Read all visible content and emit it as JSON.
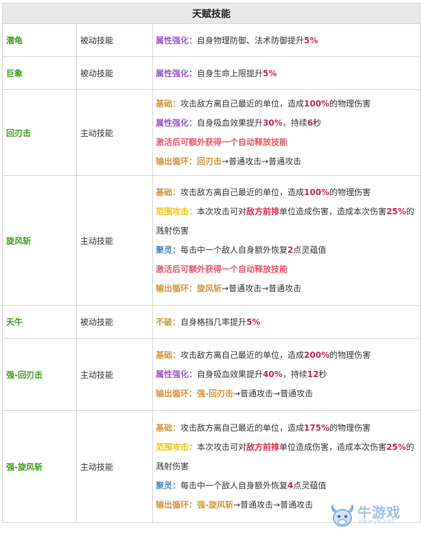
{
  "table": {
    "title": "天赋技能",
    "rows": [
      {
        "name": "潜龟",
        "type": "被动技能",
        "lines": [
          [
            {
              "t": "属性强化：",
              "c": "tag-purple"
            },
            {
              "t": "自身物理防御、法术防御提升"
            },
            {
              "t": "5%",
              "c": "val-red"
            }
          ]
        ]
      },
      {
        "name": "巨象",
        "type": "被动技能",
        "lines": [
          [
            {
              "t": "属性强化：",
              "c": "tag-purple"
            },
            {
              "t": "自身生命上限提升"
            },
            {
              "t": "5%",
              "c": "val-red"
            }
          ]
        ]
      },
      {
        "name": "回刃击",
        "type": "主动技能",
        "lines": [
          [
            {
              "t": "基础：",
              "c": "tag-orange"
            },
            {
              "t": "攻击敌方离自己最近的单位，造成"
            },
            {
              "t": "100%",
              "c": "val-red"
            },
            {
              "t": "的物理伤害"
            }
          ],
          [
            {
              "t": "属性强化：",
              "c": "tag-purple"
            },
            {
              "t": "自身吸血效果提升"
            },
            {
              "t": "30%",
              "c": "val-red"
            },
            {
              "t": "，持续"
            },
            {
              "t": "6",
              "c": "val-red"
            },
            {
              "t": "秒"
            }
          ],
          [
            {
              "t": "激活后可额外获得一个自动释放技能",
              "c": "tag-pink"
            }
          ],
          [
            {
              "t": "输出循环：",
              "c": "tag-orange"
            },
            {
              "t": "回刃击",
              "c": "tag-orange"
            },
            {
              "t": "→普通攻击→普通攻击"
            }
          ]
        ]
      },
      {
        "name": "旋风斩",
        "type": "主动技能",
        "lines": [
          [
            {
              "t": "基础：",
              "c": "tag-orange"
            },
            {
              "t": "攻击敌方离自己最近的单位，造成"
            },
            {
              "t": "100%",
              "c": "val-red"
            },
            {
              "t": "的物理伤害"
            }
          ],
          [
            {
              "t": "范围攻击：",
              "c": "tag-yellow"
            },
            {
              "t": "本次攻击可对"
            },
            {
              "t": "敌方前排",
              "c": "tag-red"
            },
            {
              "t": "单位造成伤害，造成本次伤害"
            },
            {
              "t": "25%",
              "c": "val-red"
            },
            {
              "t": "的"
            }
          ],
          [
            {
              "t": "溅射伤害"
            }
          ],
          [
            {
              "t": "聚灵：",
              "c": "tag-blue"
            },
            {
              "t": "每击中一个敌人自身额外恢复"
            },
            {
              "t": "2",
              "c": "val-red"
            },
            {
              "t": "点灵蕴值"
            }
          ],
          [
            {
              "t": "激活后可额外获得一个自动释放技能",
              "c": "tag-pink"
            }
          ],
          [
            {
              "t": "输出循环：",
              "c": "tag-orange"
            },
            {
              "t": "旋风斩",
              "c": "tag-orange"
            },
            {
              "t": "→普通攻击→普通攻击"
            }
          ]
        ]
      },
      {
        "name": "天牛",
        "type": "被动技能",
        "lines": [
          [
            {
              "t": "不破：",
              "c": "tag-orange"
            },
            {
              "t": "自身格挡几率提升"
            },
            {
              "t": "5%",
              "c": "val-red"
            }
          ]
        ]
      },
      {
        "name": "强-回刃击",
        "type": "主动技能",
        "lines": [
          [
            {
              "t": "基础：",
              "c": "tag-orange"
            },
            {
              "t": "攻击敌方离自己最近的单位，造成"
            },
            {
              "t": "200%",
              "c": "val-red"
            },
            {
              "t": "的物理伤害"
            }
          ],
          [
            {
              "t": "属性强化：",
              "c": "tag-purple"
            },
            {
              "t": "自身吸血效果提升"
            },
            {
              "t": "40%",
              "c": "val-red"
            },
            {
              "t": "，持续"
            },
            {
              "t": "12",
              "c": "val-red"
            },
            {
              "t": "秒"
            }
          ],
          [
            {
              "t": "输出循环：",
              "c": "tag-orange"
            },
            {
              "t": "强-回刃击",
              "c": "tag-orange"
            },
            {
              "t": "→普通攻击→普通攻击"
            }
          ]
        ]
      },
      {
        "name": "强-旋风斩",
        "type": "主动技能",
        "lines": [
          [
            {
              "t": "基础：",
              "c": "tag-orange"
            },
            {
              "t": "攻击敌方离自己最近的单位，造成"
            },
            {
              "t": "175%",
              "c": "val-red"
            },
            {
              "t": "的物理伤害"
            }
          ],
          [
            {
              "t": "范围攻击：",
              "c": "tag-yellow"
            },
            {
              "t": "本次攻击可对"
            },
            {
              "t": "敌方前排",
              "c": "tag-red"
            },
            {
              "t": "单位造成伤害，造成本次伤害"
            },
            {
              "t": "25%",
              "c": "val-red"
            },
            {
              "t": "的"
            }
          ],
          [
            {
              "t": "溅射伤害"
            }
          ],
          [
            {
              "t": "聚灵：",
              "c": "tag-blue"
            },
            {
              "t": "每击中一个敌人自身额外恢复"
            },
            {
              "t": "4",
              "c": "val-red"
            },
            {
              "t": "点灵蕴值"
            }
          ],
          [
            {
              "t": "输出循环：",
              "c": "tag-orange"
            },
            {
              "t": "强-旋风斩",
              "c": "tag-orange"
            },
            {
              "t": "→普通攻击→普通攻击"
            }
          ]
        ]
      }
    ]
  },
  "watermark": {
    "text": "牛游戏",
    "sub": "newyx.net",
    "icon": "bull-mascot-icon"
  }
}
